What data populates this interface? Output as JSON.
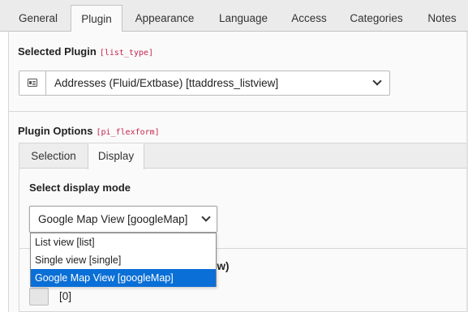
{
  "tabs": [
    {
      "label": "General",
      "active": false
    },
    {
      "label": "Plugin",
      "active": true
    },
    {
      "label": "Appearance",
      "active": false
    },
    {
      "label": "Language",
      "active": false
    },
    {
      "label": "Access",
      "active": false
    },
    {
      "label": "Categories",
      "active": false
    },
    {
      "label": "Notes",
      "active": false
    }
  ],
  "selected_plugin": {
    "label": "Selected Plugin",
    "field": "[list_type]",
    "icon": "plugin-icon",
    "value": "Addresses (Fluid/Extbase) [ttaddress_listview]"
  },
  "plugin_options": {
    "label": "Plugin Options",
    "field": "[pi_flexform]",
    "subtabs": [
      {
        "label": "Selection",
        "active": false
      },
      {
        "label": "Display",
        "active": true
      }
    ],
    "display_mode": {
      "label": "Select display mode",
      "value": "Google Map View [googleMap]",
      "options": [
        {
          "label": "List view [list]",
          "selected": false
        },
        {
          "label": "Single view [single]",
          "selected": false
        },
        {
          "label": "Google Map View [googleMap]",
          "selected": true
        }
      ]
    },
    "partial_label": "ew)",
    "checkbox_label": "[0]"
  },
  "colors": {
    "accent_selected": "#0a6fd6",
    "code_tag": "#c7254e"
  }
}
